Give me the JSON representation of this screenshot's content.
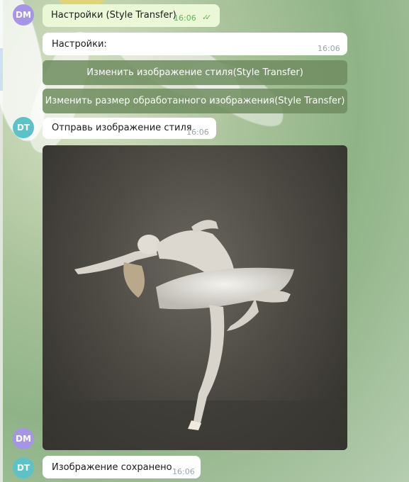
{
  "chat": {
    "messages": [
      {
        "id": "m1",
        "sender": "DM",
        "text": "Настройки (Style Transfer)",
        "time": "16:06",
        "outgoing": true
      },
      {
        "id": "m2",
        "sender": "DT",
        "text": "Настройки:",
        "time": "16:06"
      },
      {
        "id": "m4",
        "sender": "DT",
        "text": "Отправь изображение стиля",
        "time": "16:06"
      },
      {
        "id": "m6",
        "sender": "DT",
        "text": "Изображение сохранено",
        "time": "16:06"
      }
    ],
    "keyboard": [
      {
        "label": "Изменить изображение стиля(Style Transfer)"
      },
      {
        "label": "Изменить размер обработанного изображения(Style Transfer)"
      }
    ]
  },
  "avatars": {
    "dm": "DM",
    "dt": "DT"
  },
  "photo": {
    "icon": "ballerina-photo"
  },
  "colors": {
    "outgoing_bubble": "#eaf8d8",
    "incoming_bubble": "#ffffff",
    "keyboard_button": "#6e8c5f",
    "avatar_dm": "#a695e7",
    "avatar_dt": "#5bc3c7"
  }
}
